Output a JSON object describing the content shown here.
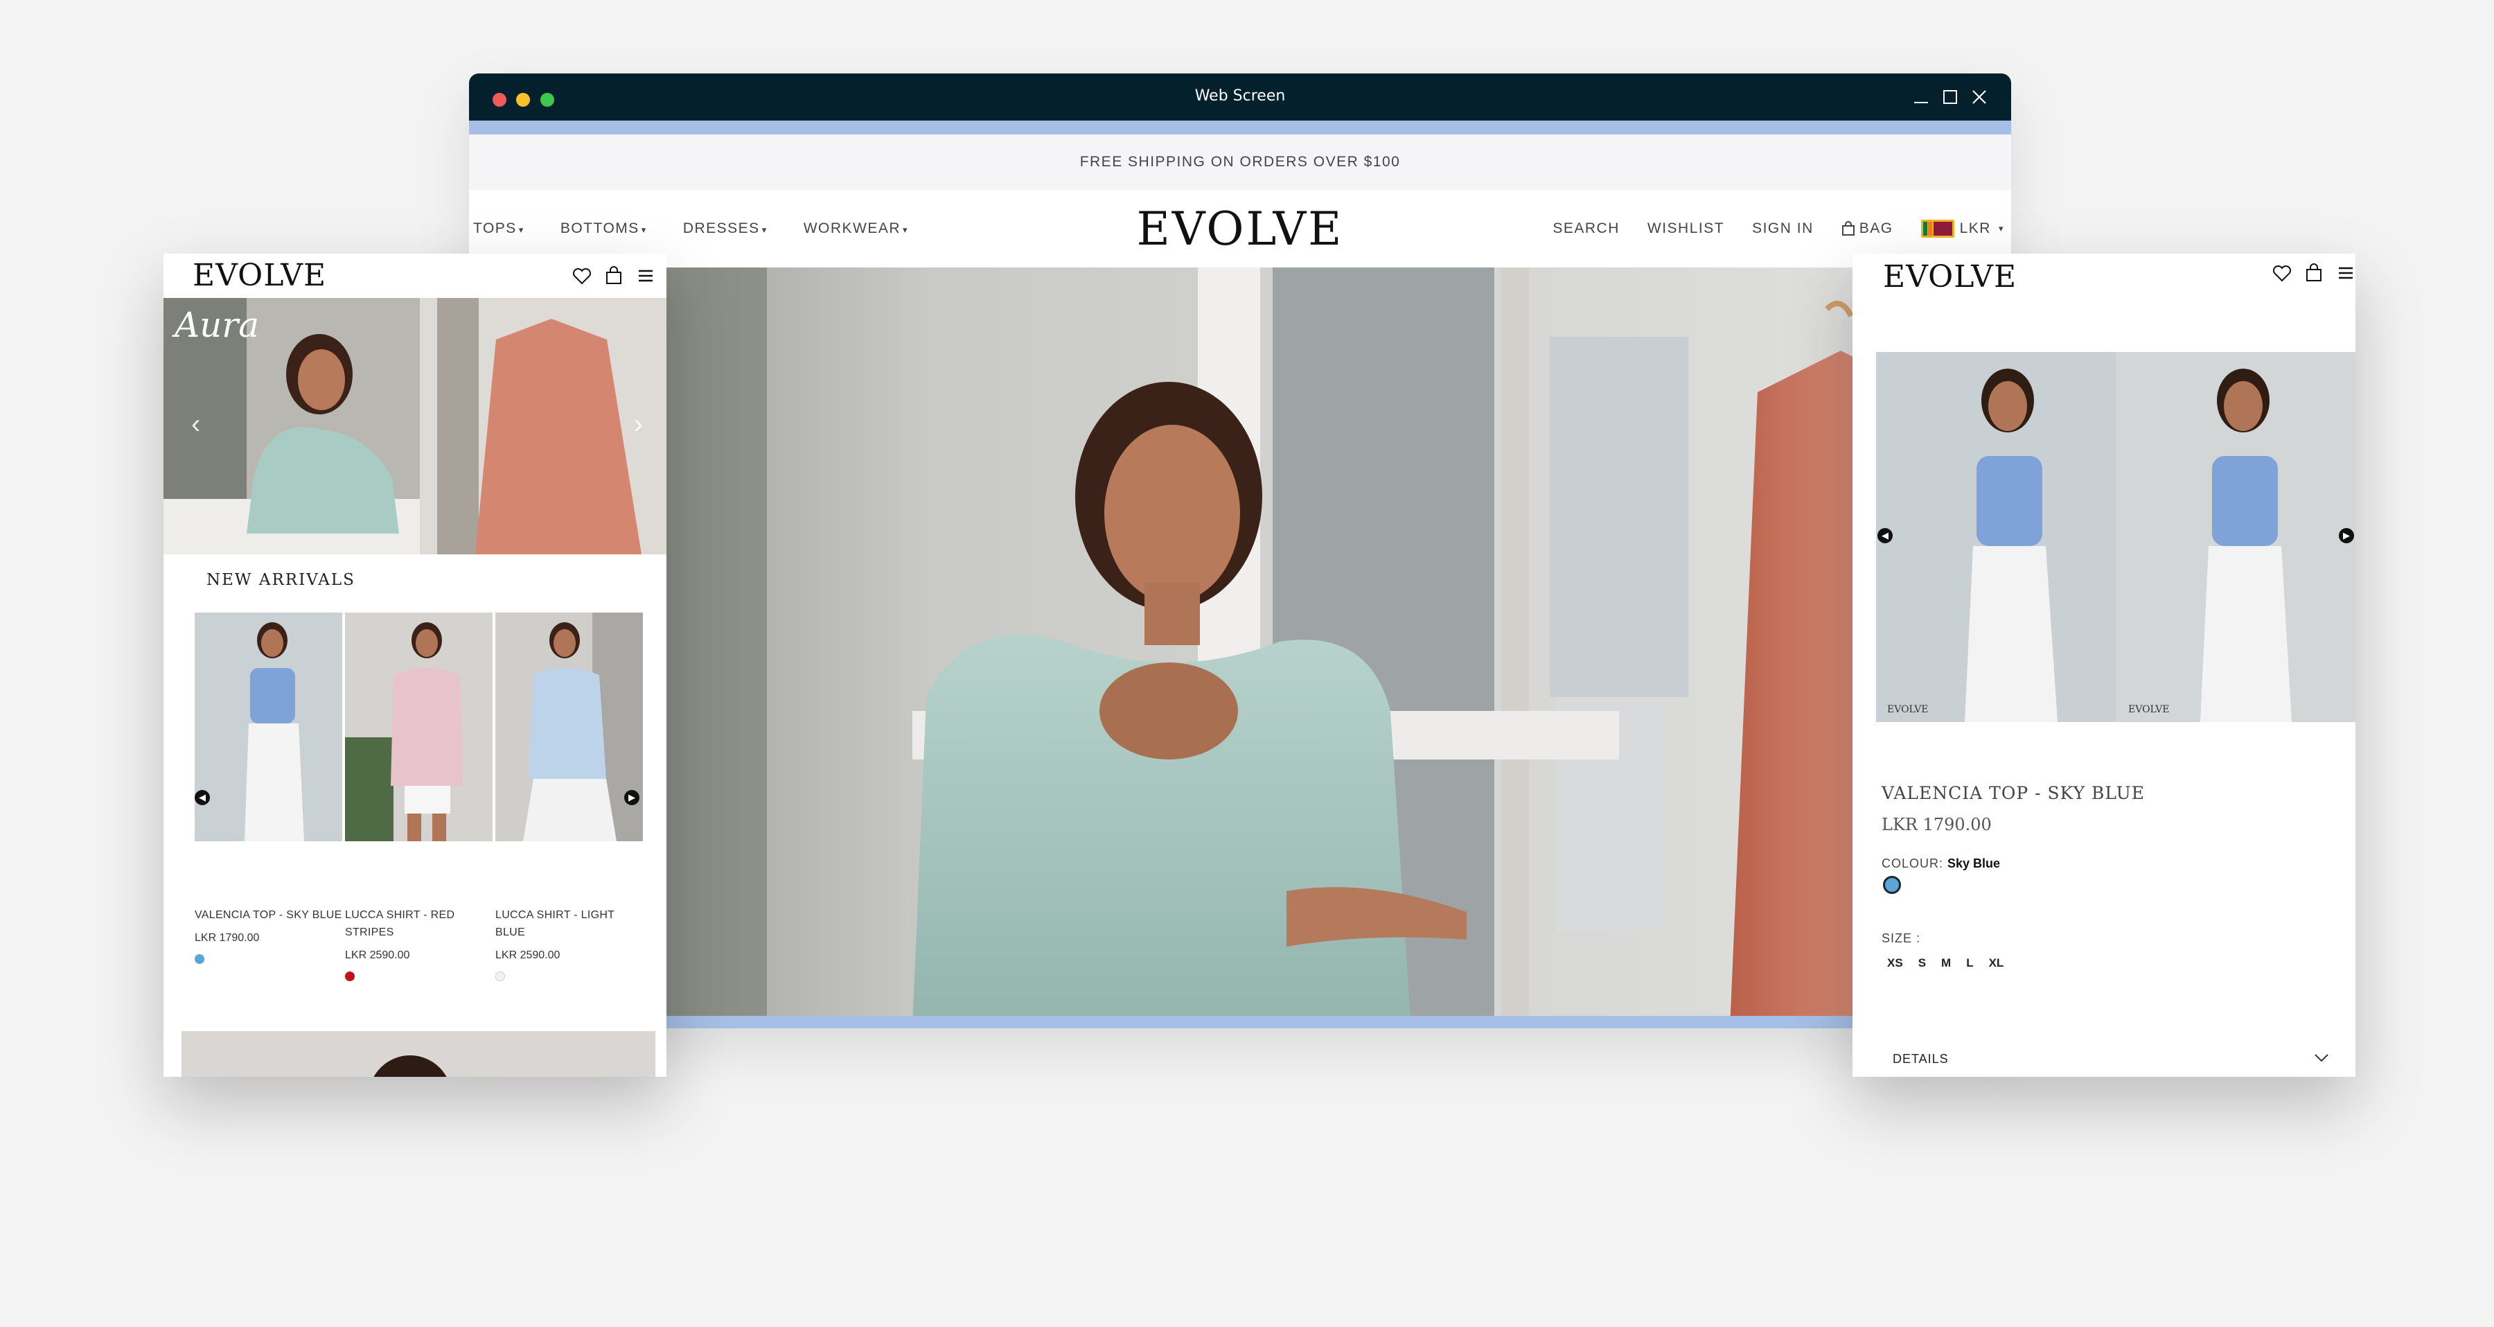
{
  "window": {
    "title": "Web Screen"
  },
  "site": {
    "announcement": "FREE SHIPPING ON ORDERS OVER $100",
    "logo": "EVOLVE",
    "nav_left": [
      {
        "label": "TOPS",
        "caret": "▾"
      },
      {
        "label": "BOTTOMS",
        "caret": "▾"
      },
      {
        "label": "DRESSES",
        "caret": "▾"
      },
      {
        "label": "WORKWEAR",
        "caret": "▾"
      }
    ],
    "nav_right": {
      "search": "SEARCH",
      "wishlist": "WISHLIST",
      "signin": "SIGN IN",
      "bag": "BAG",
      "currency": "LKR",
      "currency_caret": "▾"
    }
  },
  "mobile_home": {
    "logo": "EVOLVE",
    "banner_title": "Aura",
    "banner_prev": "‹",
    "banner_next": "›",
    "section_title": "NEW ARRIVALS",
    "carousel_prev": "◀",
    "carousel_next": "▶",
    "products": [
      {
        "name": "VALENCIA TOP - SKY BLUE",
        "price": "LKR 1790.00",
        "swatch": "#5aa6d6"
      },
      {
        "name": "LUCCA SHIRT - RED STRIPES",
        "price": "LKR 2590.00",
        "swatch": "#c0121d"
      },
      {
        "name": "LUCCA SHIRT - LIGHT BLUE",
        "price": "LKR 2590.00",
        "swatch": "#f2f2f2"
      }
    ]
  },
  "mobile_product": {
    "logo": "EVOLVE",
    "image_watermark": "EVOLVE",
    "gallery_prev": "◀",
    "gallery_next": "▶",
    "title": "VALENCIA TOP - SKY BLUE",
    "price": "LKR 1790.00",
    "colour_label": "COLOUR:",
    "colour_value": "Sky Blue",
    "colour_swatch": "#5aa6d6",
    "size_label": "SIZE :",
    "sizes": [
      "XS",
      "S",
      "M",
      "L",
      "XL"
    ],
    "details_label": "DETAILS"
  },
  "colors": {
    "titlebar": "#05202d",
    "accent_strip": "#a6bfe6",
    "page_bg": "#f3f3f3"
  }
}
